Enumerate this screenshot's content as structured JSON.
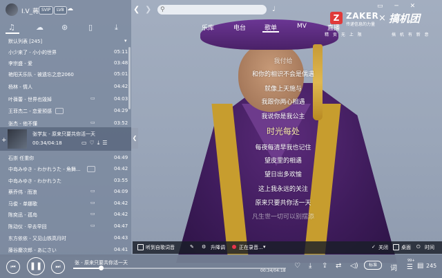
{
  "app": {
    "username": "I.V_蒋",
    "badge_vip": "SVIP",
    "badge_level": "LV8"
  },
  "header": {
    "tabs": [
      "乐库",
      "电台",
      "歌单",
      "MV",
      "直播"
    ],
    "active_tab": "歌单"
  },
  "watermark": {
    "zaker": "ZAKER",
    "zaker_sub": "传递信息的力量",
    "times": "×",
    "gao": "搞机团",
    "gao_sub": "搞 机 有 新 意",
    "sub_a": "精 贡 无 上 限"
  },
  "left_tabs": [
    "♫",
    "☁",
    "⊛",
    "▯",
    "⤓"
  ],
  "playlist": {
    "title": "默认列表 [245]",
    "rows": [
      {
        "title": "小少来了 - 小小的世界",
        "duration": "05:11"
      },
      {
        "title": "李宗盛 - 爱",
        "duration": "03:48"
      },
      {
        "title": "艳阳天乐队 - 被遗忘之恋2060",
        "duration": "05:01"
      },
      {
        "title": "杨林 - 情人",
        "duration": "04:42"
      },
      {
        "title": "叶蒨蕾 - 世界也毁掉",
        "duration": "04:03"
      },
      {
        "title": "王菲杰二 - 恋爱预感",
        "duration": "04:29"
      },
      {
        "title": "张杰 - 他不懂",
        "duration": "03:52"
      },
      {
        "title": "石崇 任重你",
        "duration": "04:49"
      },
      {
        "title": "中岛みゆき - わかれうた - 角舞...",
        "duration": "04:42"
      },
      {
        "title": "中岛みゆき - わかれうた",
        "duration": "03:55"
      },
      {
        "title": "蔡乔伟 · 而浪",
        "duration": "04:09"
      },
      {
        "title": "马俊 - 单娜歌",
        "duration": "04:42"
      },
      {
        "title": "陈奕迅 - 孤岛",
        "duration": "04:42"
      },
      {
        "title": "陈动仪 · 早去早回",
        "duration": "04:47"
      },
      {
        "title": "东方依依 - 又见山铁高月时",
        "duration": "04:43"
      },
      {
        "title": "藤谷慶次郎 - あにさい",
        "duration": "04:41"
      }
    ],
    "current": {
      "title": "张学友 - 原来只要共你活一天",
      "time": "00:34/04:18"
    }
  },
  "lyrics": [
    "我付给",
    "和你的相识不会是偶遇",
    "就像上天施与",
    "我跟你两心相遇",
    "我说你是我公主",
    "时光每处",
    "每夜每清早我也记住",
    "望皮里的相遇",
    "望日出多欢愉",
    "这上我永远的关注",
    "原来只要共你活一天",
    "凡生世一切可以别摆添"
  ],
  "lyric_bar": {
    "show_desktop": "听到自歌词音",
    "pen": "✎",
    "translate": "升降调",
    "record": "正在录音...",
    "lock": "关闭",
    "desktop": "桌面",
    "offset": "时间"
  },
  "player": {
    "now_title": "张 - 原来只要共你活一天",
    "now_time": "00:34/04:18",
    "progress": 0.13,
    "speed_label": "标准",
    "lyric_btn": "词",
    "count": "245",
    "new_badge": "99+"
  }
}
